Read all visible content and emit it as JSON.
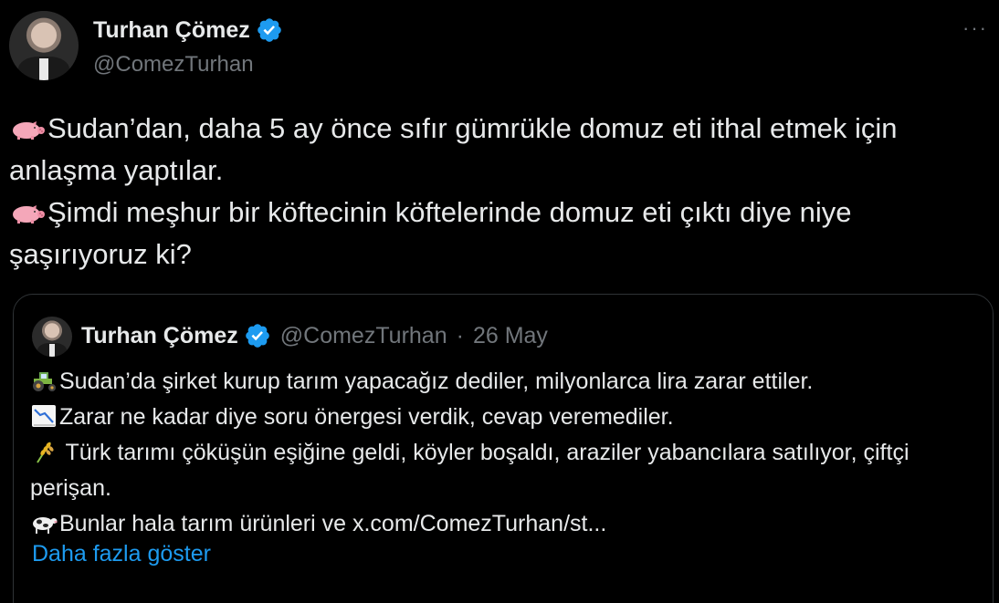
{
  "author": {
    "name": "Turhan Çömez",
    "handle": "@ComezTurhan",
    "verified": true,
    "avatar_icon": "profile-photo"
  },
  "more_label": "···",
  "body": {
    "line1_icon": "pig-icon",
    "line1": "Sudan’dan, daha 5 ay önce sıfır gümrükle domuz eti ithal etmek için anlaşma yaptılar.",
    "line2_icon": "pig-icon",
    "line2": "Şimdi meşhur bir köftecinin köftelerinde domuz eti çıktı diye niye şaşırıyoruz ki?"
  },
  "quote": {
    "name": "Turhan Çömez",
    "handle": "@ComezTurhan",
    "separator": "·",
    "date": "26 May",
    "lines": [
      {
        "icon": "tractor-icon",
        "text": "Sudan’da şirket kurup tarım yapacağız dediler, milyonlarca lira zarar ettiler."
      },
      {
        "icon": "chart-decreasing-icon",
        "text": "Zarar ne kadar diye soru önergesi verdik, cevap veremediler."
      },
      {
        "icon": "wheat-icon",
        "text": " Türk tarımı çöküşün eşiğine geldi, köyler boşaldı, araziler yabancılara satılıyor, çiftçi perişan."
      },
      {
        "icon": "cow-icon",
        "text": "Bunlar hala tarım ürünleri ve  x.com/ComezTurhan/st..."
      }
    ],
    "show_more": "Daha fazla göster"
  },
  "colors": {
    "background": "#000000",
    "text": "#e7e9ea",
    "muted": "#71767b",
    "link": "#1d9bf0",
    "verified": "#1d9bf0",
    "border": "#2f3336"
  }
}
